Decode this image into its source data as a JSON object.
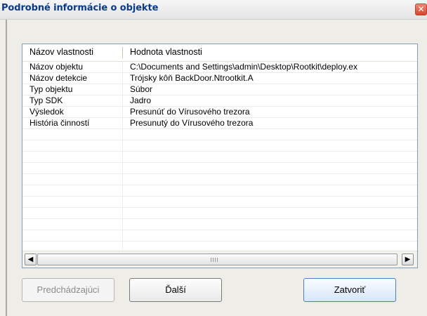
{
  "window": {
    "title": "Podrobné informácie o objekte",
    "close_glyph": "✕"
  },
  "table": {
    "columns": [
      "Názov vlastnosti",
      "Hodnota vlastnosti"
    ],
    "rows": [
      {
        "name": "Názov objektu",
        "value": "C:\\Documents and Settings\\admin\\Desktop\\Rootkit\\deploy.ex"
      },
      {
        "name": "Názov detekcie",
        "value": "Trójsky kôň BackDoor.Ntrootkit.A"
      },
      {
        "name": "Typ objektu",
        "value": "Súbor"
      },
      {
        "name": "Typ SDK",
        "value": "Jadro"
      },
      {
        "name": "Výsledok",
        "value": "Presunúť do Vírusového trezora"
      },
      {
        "name": "História činností",
        "value": "Presunutý do Vírusového trezora"
      }
    ],
    "empty_row_count": 11
  },
  "scrollbar": {
    "left_glyph": "◀",
    "right_glyph": "▶"
  },
  "buttons": {
    "previous": "Predchádzajúci",
    "next": "Ďalší",
    "close": "Zatvoriť"
  },
  "colors": {
    "title_text": "#0b3a87",
    "close_button": "#d8452f",
    "primary_button_border": "#4f7fb6"
  }
}
